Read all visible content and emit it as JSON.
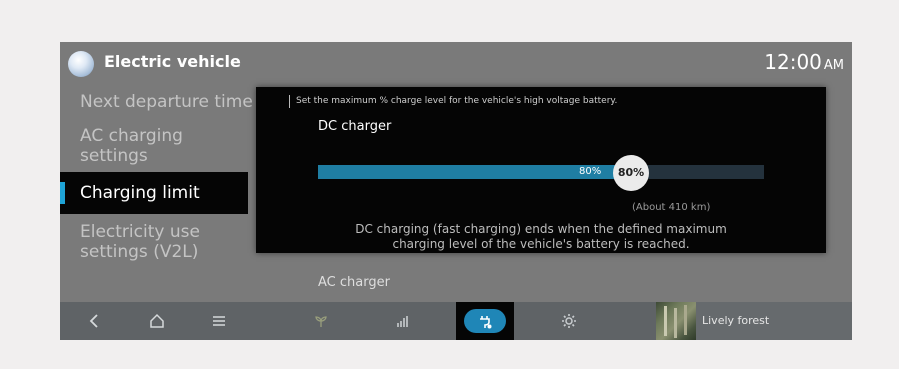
{
  "header": {
    "app_icon": "earth-globe-icon",
    "title": "Electric vehicle",
    "time": "12:00",
    "ampm": "AM"
  },
  "menu": {
    "items": [
      {
        "label": "Next departure time",
        "active": false
      },
      {
        "label": "AC charging settings",
        "active": false
      },
      {
        "label": "Charging limit",
        "active": true
      },
      {
        "label": "Electricity use settings (V2L)",
        "active": false
      }
    ]
  },
  "panel": {
    "description": "Set the maximum % charge level for the vehicle's high voltage battery.",
    "dc_charger_label": "DC charger",
    "dc_limit_percent": 80,
    "dc_fill_label": "80%",
    "dc_knob_label": "80%",
    "range_text": "(About 410 km)",
    "note_line1": "DC charging (fast charging) ends when the defined maximum",
    "note_line2": "charging level of the vehicle's battery is reached."
  },
  "ac_charger_label": "AC charger",
  "bottom_nav": {
    "back_icon": "back-chevron-icon",
    "home_icon": "home-icon",
    "menu_icon": "menu-lines-icon",
    "eco_icon": "leaf-icon",
    "energy_icon": "bar-graph-icon",
    "ev_icon": "ev-plug-icon",
    "settings_icon": "gear-icon",
    "media_title": "Lively forest"
  },
  "colors": {
    "accent": "#1ea3d6",
    "bar_fill": "#1f7ea3",
    "active_pill": "#1f86b7"
  }
}
